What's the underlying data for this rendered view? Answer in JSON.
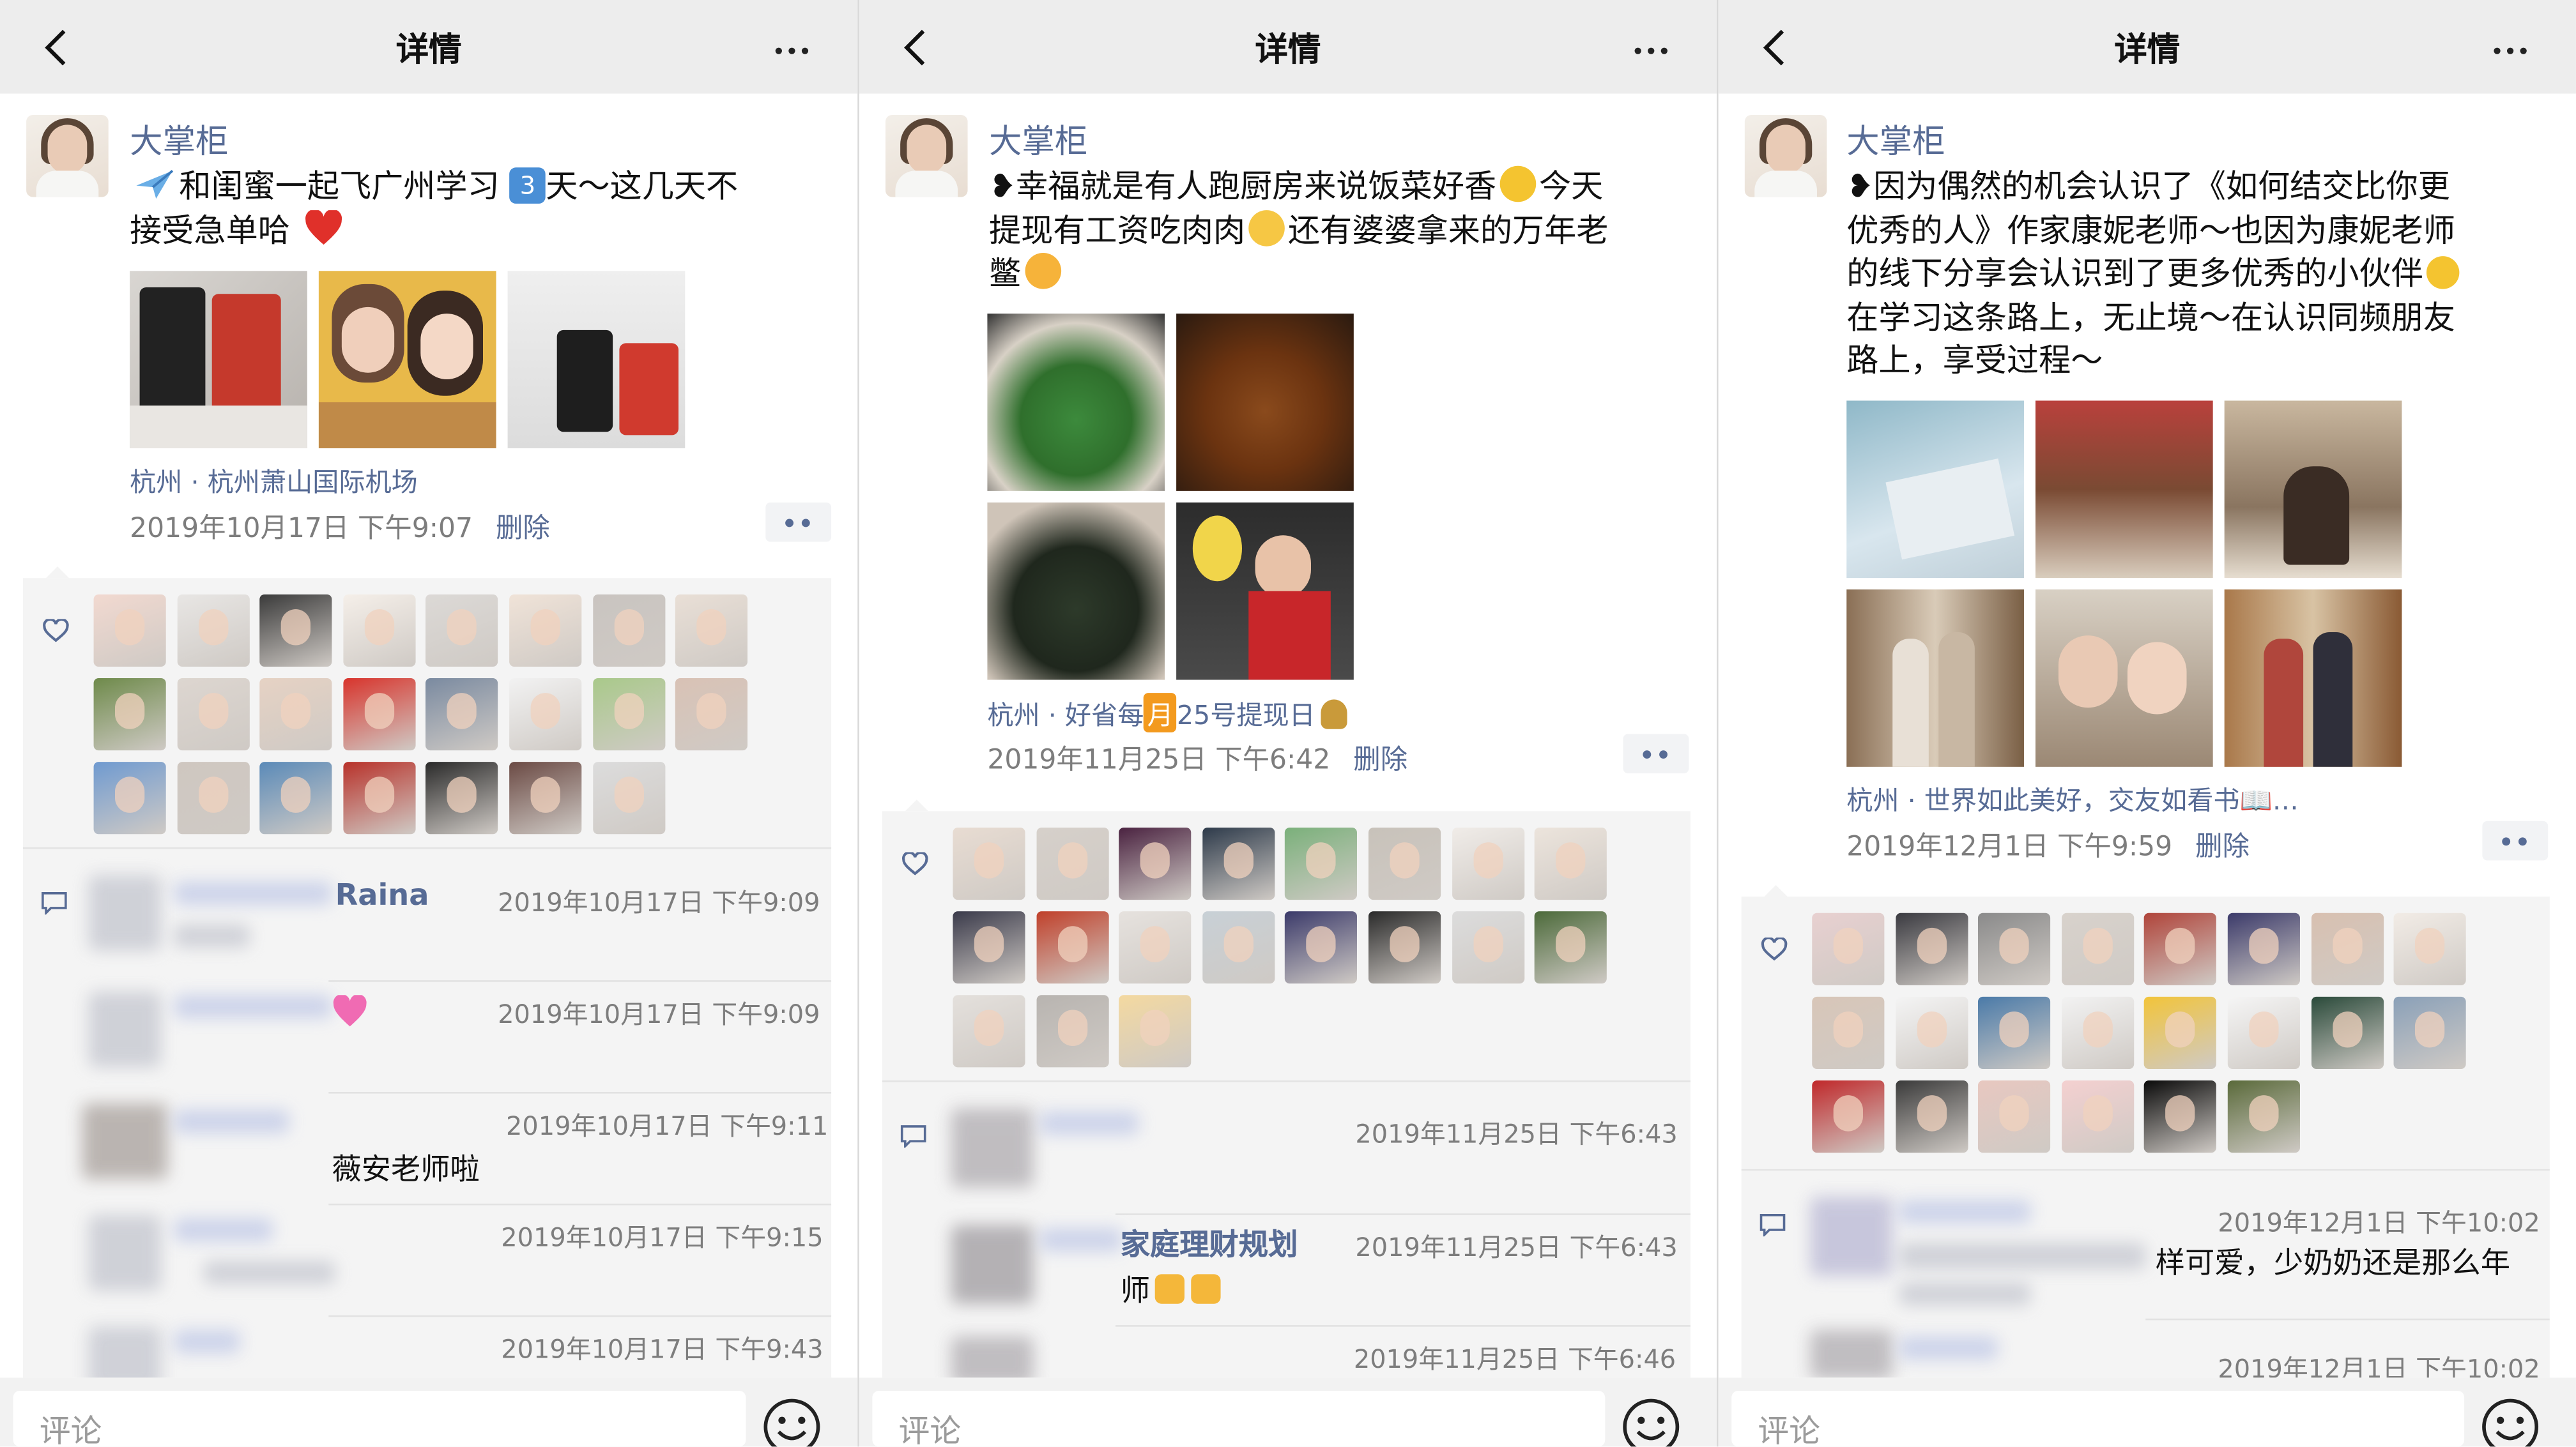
{
  "panels": [
    {
      "nav_title": "详情",
      "user": "大掌柜",
      "post_lines": [
        {
          "pre_icon": "airplane-icon",
          "parts": [
            "和闺蜜一起飞广州学习 ",
            "3",
            "天～这几天不"
          ],
          "line2": "接受急单哈"
        },
        null
      ],
      "post_text_1": "和闺蜜一起飞广州学习",
      "post_num": "3",
      "post_text_2": "天～这几天不",
      "post_text_3": "接受急单哈",
      "location": "杭州 · 杭州萧山国际机场",
      "time": "2019年10月17日 下午9:07",
      "delete": "删除",
      "comments": [
        {
          "name": "Raina",
          "time": "2019年10月17日 下午9:09",
          "text": ""
        },
        {
          "name": "",
          "time": "2019年10月17日 下午9:09",
          "text": ""
        },
        {
          "name": "",
          "time": "2019年10月17日 下午9:11",
          "text": "薇安老师啦"
        },
        {
          "name": "",
          "time": "2019年10月17日 下午9:15",
          "text": ""
        },
        {
          "name": "",
          "time": "2019年10月17日 下午9:43",
          "text": ""
        }
      ],
      "input_placeholder": "评论"
    },
    {
      "nav_title": "详情",
      "user": "大掌柜",
      "post_text_1": "幸福就是有人跑厨房来说饭菜好香",
      "post_text_2": "今天",
      "post_text_3": "提现有工资吃肉肉",
      "post_text_4": "还有婆婆拿来的万年老",
      "post_text_5": "鳖",
      "location_1": "杭州 · 好省每",
      "location_month": "月",
      "location_2": "25号提现日",
      "time": "2019年11月25日 下午6:42",
      "delete": "删除",
      "comments": [
        {
          "name": "",
          "time": "2019年11月25日 下午6:43",
          "text": ""
        },
        {
          "name": "家庭理财规划",
          "time": "2019年11月25日 下午6:43",
          "text": "师"
        },
        {
          "name": "",
          "time": "2019年11月25日 下午6:46",
          "text": ""
        }
      ],
      "input_placeholder": "评论"
    },
    {
      "nav_title": "详情",
      "user": "大掌柜",
      "post_lines": [
        "因为偶然的机会认识了《如何结交比你更",
        "优秀的人》作家康妮老师～也因为康妮老师",
        "的线下分享会认识到了更多优秀的小伙伴",
        "在学习这条路上，无止境～在认识同频朋友",
        "路上，享受过程～"
      ],
      "location": "杭州 · 世界如此美好，交友如看书📖…",
      "time": "2019年12月1日 下午9:59",
      "delete": "删除",
      "comments": [
        {
          "name": "",
          "time": "2019年12月1日 下午10:02",
          "text": "样可爱，少奶奶还是那么年"
        },
        {
          "name": "",
          "time": "2019年12月1日 下午10:02",
          "text": ""
        }
      ],
      "input_placeholder": "评论"
    }
  ],
  "colors": {
    "link": "#576b95",
    "nav_bg": "#ededed",
    "comment_bg": "#f4f4f4",
    "time_grey": "#7d7d7d"
  }
}
